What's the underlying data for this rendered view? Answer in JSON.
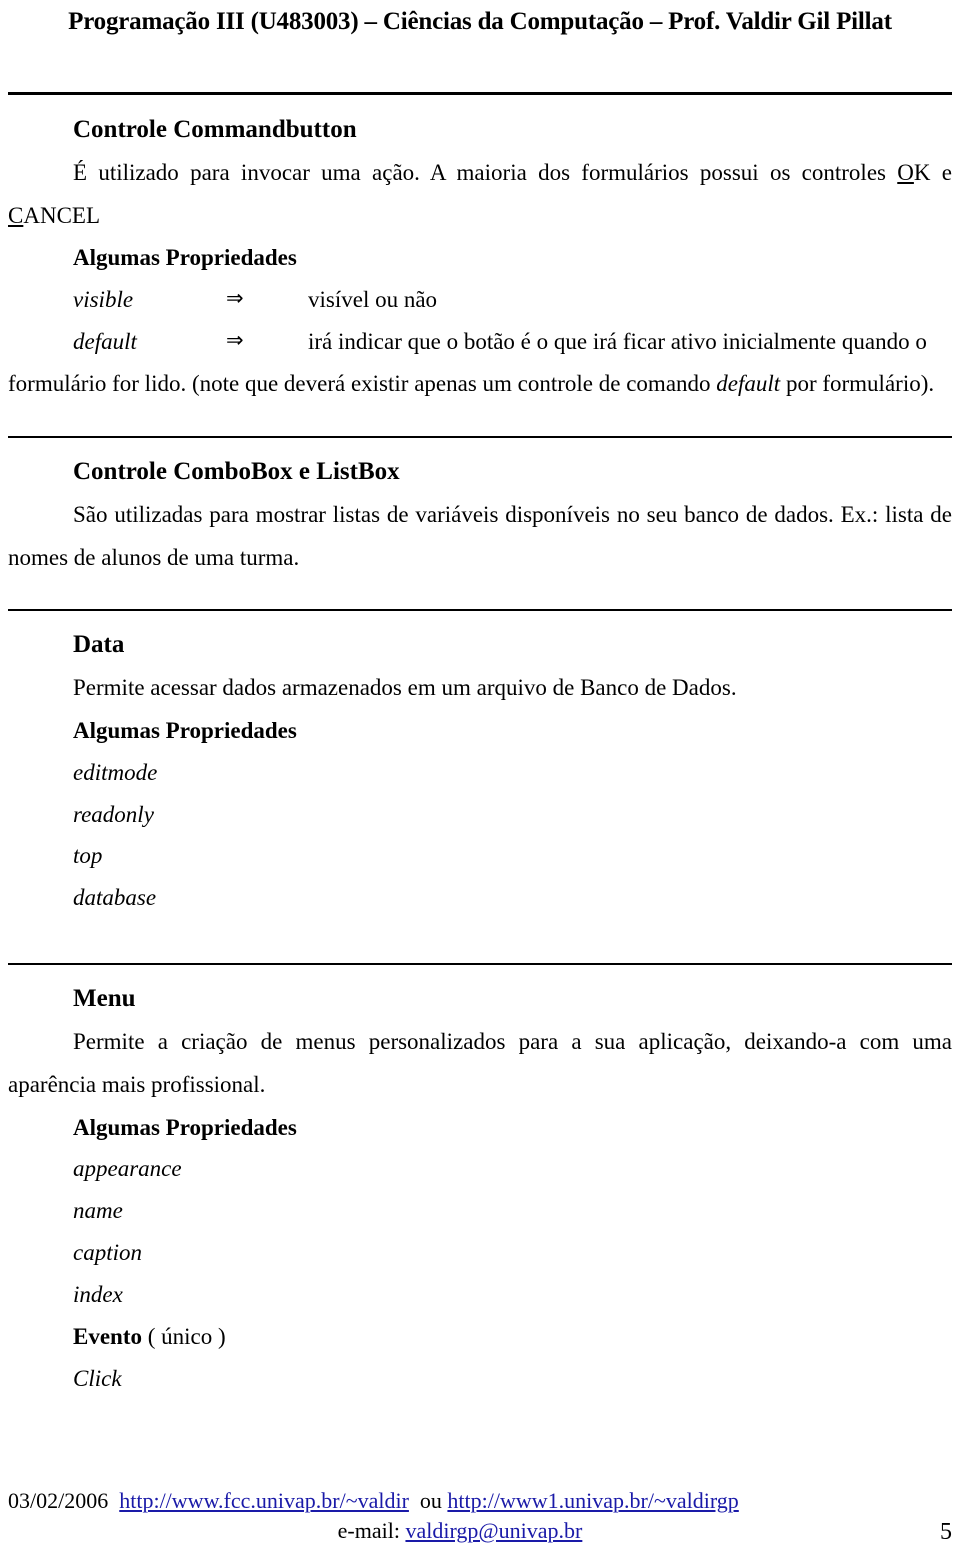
{
  "header": {
    "title": "Programação III (U483003) – Ciências da Computação – Prof. Valdir Gil Pillat"
  },
  "sections": [
    {
      "id": "commandbutton",
      "title": "Controle Commandbutton",
      "intro_part1": "É utilizado para invocar uma ação. A maioria dos formulários possui os controles ",
      "intro_ok_accel": "O",
      "intro_ok_rest": "K",
      "intro_mid": " e ",
      "intro_cancel_accel": "C",
      "intro_cancel_rest": "ANCEL",
      "props_heading": "Algumas Propriedades",
      "arrow": "⇒",
      "props": [
        {
          "name": "visible",
          "desc": "visível ou não"
        },
        {
          "name": "default",
          "desc": "irá indicar que o botão é o que irá ficar ativo inicialmente quando o"
        }
      ],
      "note_pre": "formulário for lido. (note que deverá existir apenas um controle de comando ",
      "note_ital": "default",
      "note_post": " por formulário)."
    },
    {
      "id": "combobox",
      "title": "Controle ComboBox e ListBox",
      "body": "São utilizadas para mostrar listas de variáveis disponíveis no seu banco de dados. Ex.: lista de nomes de alunos de uma turma."
    },
    {
      "id": "data",
      "title": "Data",
      "body": "Permite acessar dados armazenados em um arquivo de Banco de Dados.",
      "props_heading": "Algumas Propriedades",
      "props": [
        "editmode",
        "readonly",
        "top",
        "database"
      ]
    },
    {
      "id": "menu",
      "title": "Menu",
      "body": "Permite a criação de menus personalizados para a sua aplicação, deixando-a com uma aparência mais profissional.",
      "props_heading": "Algumas Propriedades",
      "props": [
        "appearance",
        "name",
        "caption",
        "index"
      ],
      "evento_label": "Evento",
      "evento_suffix": " ( único )",
      "evento_items": [
        "Click"
      ]
    }
  ],
  "footer": {
    "date": "03/02/2006",
    "url1": "http://www.fcc.univap.br/~valdir",
    "conjunction": "ou",
    "url2": "http://www1.univap.br/~valdirgp",
    "email_label": "e-mail:",
    "email": "valdirgp@univap.br",
    "page_number": "5"
  },
  "colors": {
    "link": "#1a1aa8",
    "text": "#000000",
    "background": "#ffffff"
  }
}
